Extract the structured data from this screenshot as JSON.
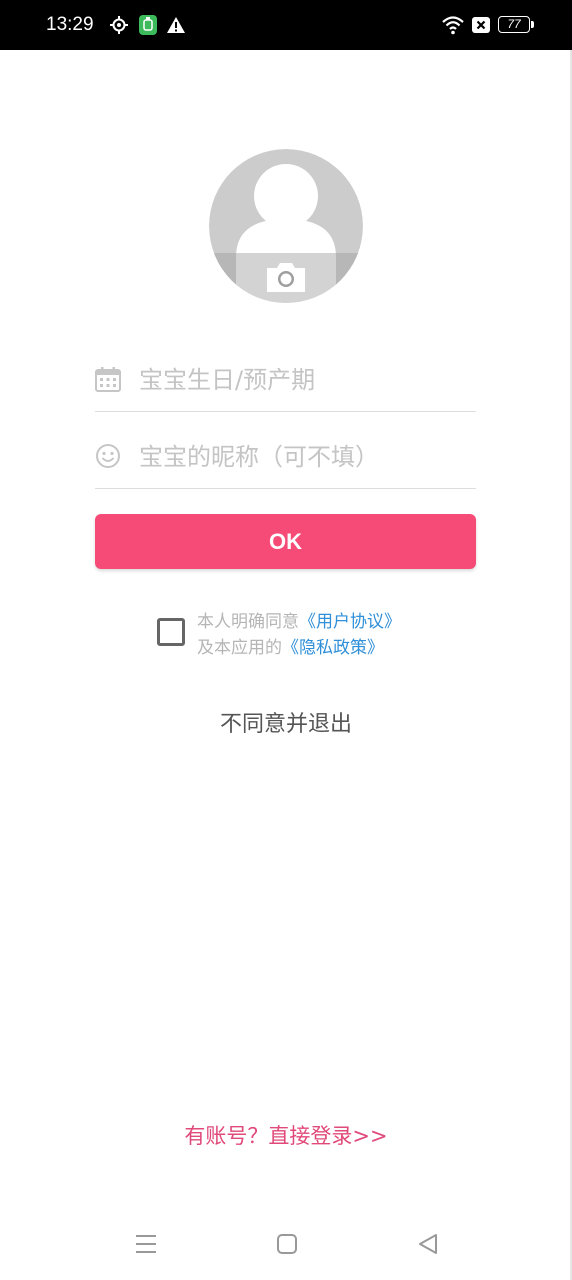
{
  "status_bar": {
    "time": "13:29",
    "battery": "77",
    "icons": [
      "location-icon",
      "app-notification-icon",
      "warning-icon",
      "wifi-icon",
      "no-sim-icon",
      "battery-icon"
    ]
  },
  "avatar": {
    "icon": "default-avatar-icon",
    "camera_icon": "camera-icon"
  },
  "form": {
    "birthday": {
      "icon": "calendar-icon",
      "placeholder": "宝宝生日/预产期",
      "value": ""
    },
    "nickname": {
      "icon": "smiley-icon",
      "placeholder": "宝宝的昵称（可不填）",
      "value": ""
    },
    "ok_label": "OK"
  },
  "agreement": {
    "checked": false,
    "line1_prefix": "本人明确同意",
    "user_agreement_link": "《用户协议》",
    "line2_prefix": "及本应用的",
    "privacy_policy_link": "《隐私政策》"
  },
  "exit_label": "不同意并退出",
  "login_label": "有账号？直接登录>>",
  "nav": {
    "menu": "menu-icon",
    "home": "home-icon",
    "back": "back-icon"
  },
  "colors": {
    "accent": "#f64b76",
    "login_text": "#e0497a",
    "link": "#2f8fd8",
    "placeholder": "#c4c4c4"
  }
}
